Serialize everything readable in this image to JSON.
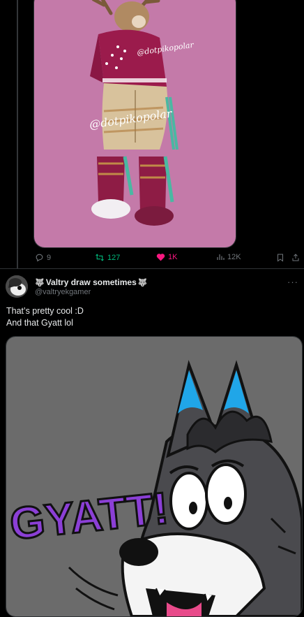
{
  "previous_post": {
    "image_alt": "Artwork of a reindeer character in a red sweater and boots",
    "watermark": "@dotpikopolar",
    "stats": {
      "replies": "9",
      "reposts": "127",
      "likes": "1K",
      "views": "12K"
    }
  },
  "reply": {
    "display_name": "Valtry draw sometimes",
    "handle": "@valtryekgamer",
    "text_line1": "That’s pretty cool :D",
    "text_line2": "And that Gyatt lol",
    "image_text": "GYATT!",
    "more_label": "···"
  },
  "colors": {
    "background": "#000000",
    "like_pink": "#f91880",
    "repost_green": "#00ba7c",
    "muted": "#71767b",
    "art_bg_pink": "#c47aa9",
    "art_bg_gray": "#6b6b6b",
    "gyatt_purple": "#8b3fd6"
  },
  "icons": [
    "reply-icon",
    "repost-icon",
    "like-icon",
    "views-icon",
    "bookmark-icon",
    "share-icon",
    "wolf-emoji-icon"
  ]
}
